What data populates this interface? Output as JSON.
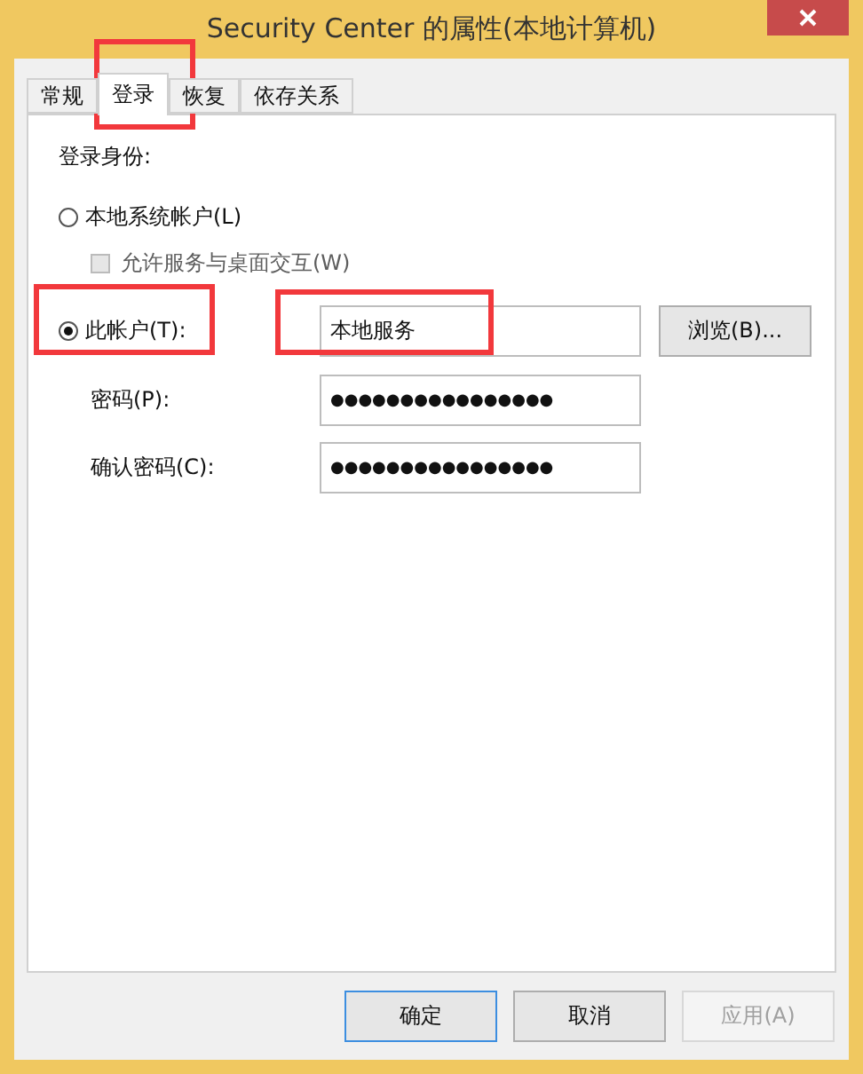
{
  "window": {
    "title": "Security Center 的属性(本地计算机)"
  },
  "tabs": [
    {
      "label": "常规",
      "selected": false
    },
    {
      "label": "登录",
      "selected": true
    },
    {
      "label": "恢复",
      "selected": false
    },
    {
      "label": "依存关系",
      "selected": false
    }
  ],
  "logon": {
    "heading": "登录身份:",
    "local_system": {
      "label": "本地系统帐户(L)",
      "selected": false
    },
    "desktop_interact": {
      "label": "允许服务与桌面交互(W)",
      "checked": false,
      "disabled": true
    },
    "this_account": {
      "label": "此帐户(T):",
      "selected": true,
      "value": "本地服务",
      "browse": "浏览(B)..."
    },
    "password": {
      "label": "密码(P):",
      "value": "●●●●●●●●●●●●●●●●"
    },
    "confirm": {
      "label": "确认密码(C):",
      "value": "●●●●●●●●●●●●●●●●"
    }
  },
  "buttons": [
    {
      "label": "确定",
      "default": true,
      "disabled": false
    },
    {
      "label": "取消",
      "default": false,
      "disabled": false
    },
    {
      "label": "应用(A)",
      "default": false,
      "disabled": true
    }
  ]
}
